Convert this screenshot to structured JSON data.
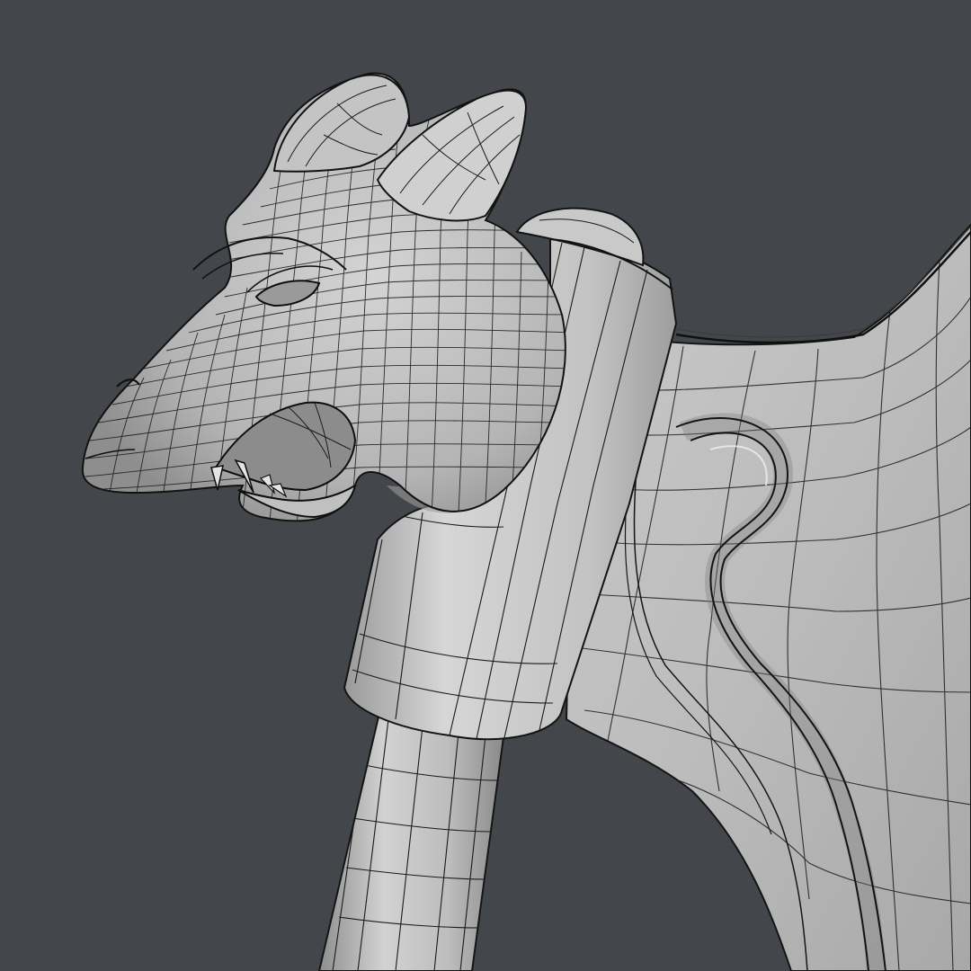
{
  "viewport": {
    "background_color": "#43474b",
    "shading": "solid",
    "overlay": "wireframe",
    "mesh_base_color": "#c8c8c8",
    "wire_color": "#111111"
  },
  "model": {
    "parts": [
      "creature-head",
      "creature-ear-left",
      "creature-ear-right",
      "collar-cylinder",
      "handle-shaft",
      "blade-body",
      "blade-groove"
    ]
  }
}
